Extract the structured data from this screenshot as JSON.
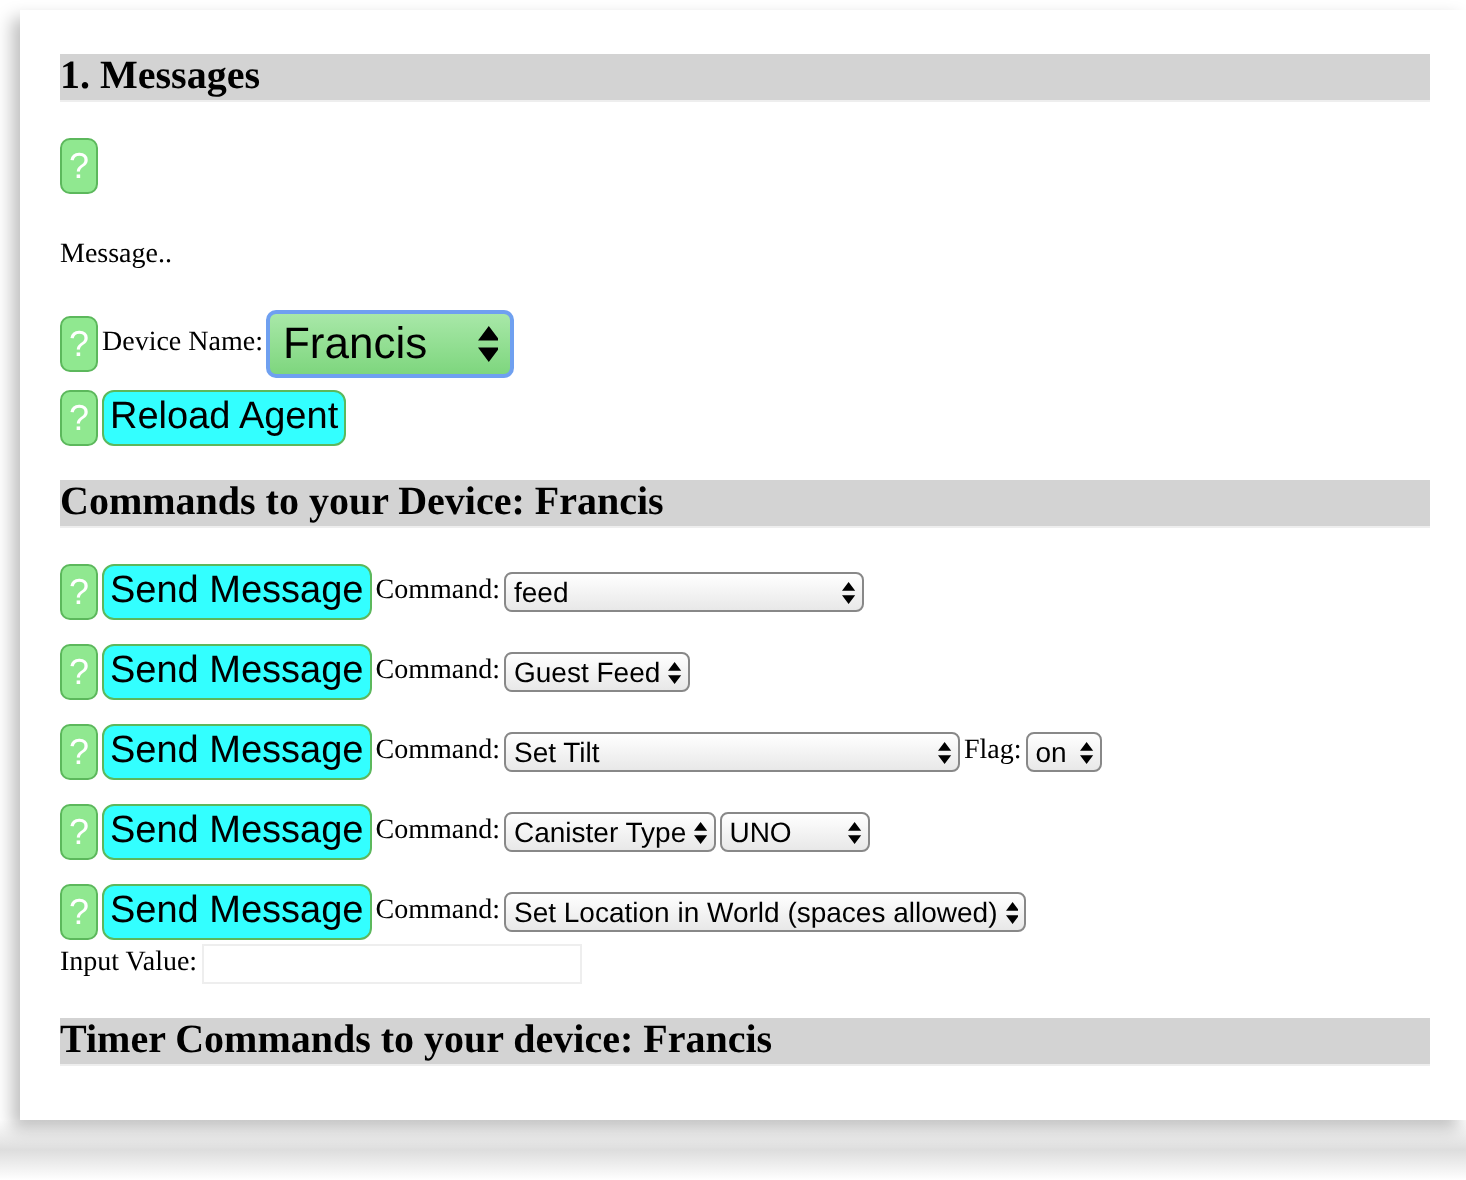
{
  "messages_heading": "1. Messages",
  "top_help": "?",
  "message_text": "Message..",
  "device": {
    "help": "?",
    "label": "Device Name:",
    "value": "Francis",
    "focused": true
  },
  "reload": {
    "help": "?",
    "label": "Reload Agent"
  },
  "commands_heading": "Commands to your Device: Francis",
  "commands": [
    {
      "help": "?",
      "button": "Send Message",
      "label": "Command:",
      "selects": [
        {
          "value": "feed"
        }
      ]
    },
    {
      "help": "?",
      "button": "Send Message",
      "label": "Command:",
      "selects": [
        {
          "value": "Guest Feed"
        }
      ]
    },
    {
      "help": "?",
      "button": "Send Message",
      "label": "Command:",
      "selects": [
        {
          "value": "Set Tilt"
        },
        {
          "label": "Flag:",
          "value": "on"
        }
      ]
    },
    {
      "help": "?",
      "button": "Send Message",
      "label": "Command:",
      "selects": [
        {
          "value": "Canister Type"
        },
        {
          "value": "UNO"
        }
      ]
    },
    {
      "help": "?",
      "button": "Send Message",
      "label": "Command:",
      "selects": [
        {
          "value": "Set Location in World (spaces allowed)"
        }
      ]
    }
  ],
  "input": {
    "label": "Input Value:"
  },
  "timer_heading": "Timer Commands to your device: Francis"
}
